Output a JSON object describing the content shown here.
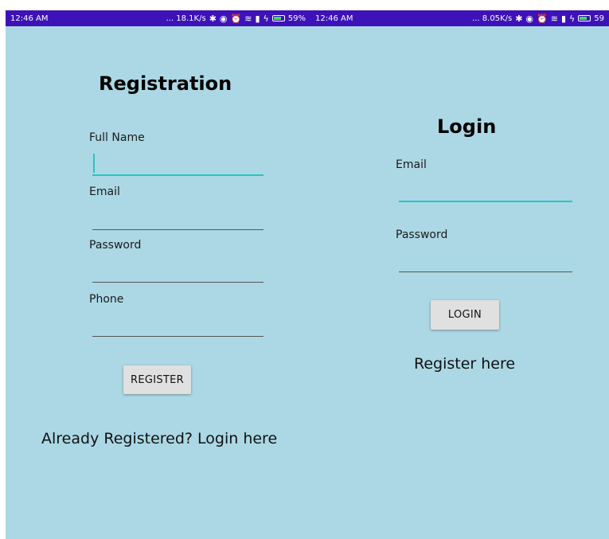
{
  "registration_screen": {
    "status_bar": {
      "time": "12:46 AM",
      "speed": "... 18.1K/s",
      "battery": "59%"
    },
    "title": "Registration",
    "full_name_label": "Full Name",
    "full_name_value": "",
    "email_label": "Email",
    "email_value": "",
    "password_label": "Password",
    "password_value": "",
    "phone_label": "Phone",
    "phone_value": "",
    "register_button": "REGISTER",
    "login_link": "Already Registered? Login here"
  },
  "login_screen": {
    "status_bar": {
      "time": "12:46 AM",
      "speed": "... 8.05K/s",
      "battery": "59"
    },
    "title": "Login",
    "email_label": "Email",
    "email_value": "",
    "password_label": "Password",
    "password_value": "",
    "login_button": "LOGIN",
    "register_link": "Register here"
  },
  "icons": [
    "bluetooth-icon",
    "eye-icon",
    "alarm-icon",
    "wifi-icon",
    "signal-icon",
    "charging-icon",
    "battery-icon"
  ],
  "colors": {
    "status_bar": "#3d12b8",
    "background": "#acd8e5",
    "focus_accent": "#20c9c0",
    "button": "#e0e0e0"
  }
}
